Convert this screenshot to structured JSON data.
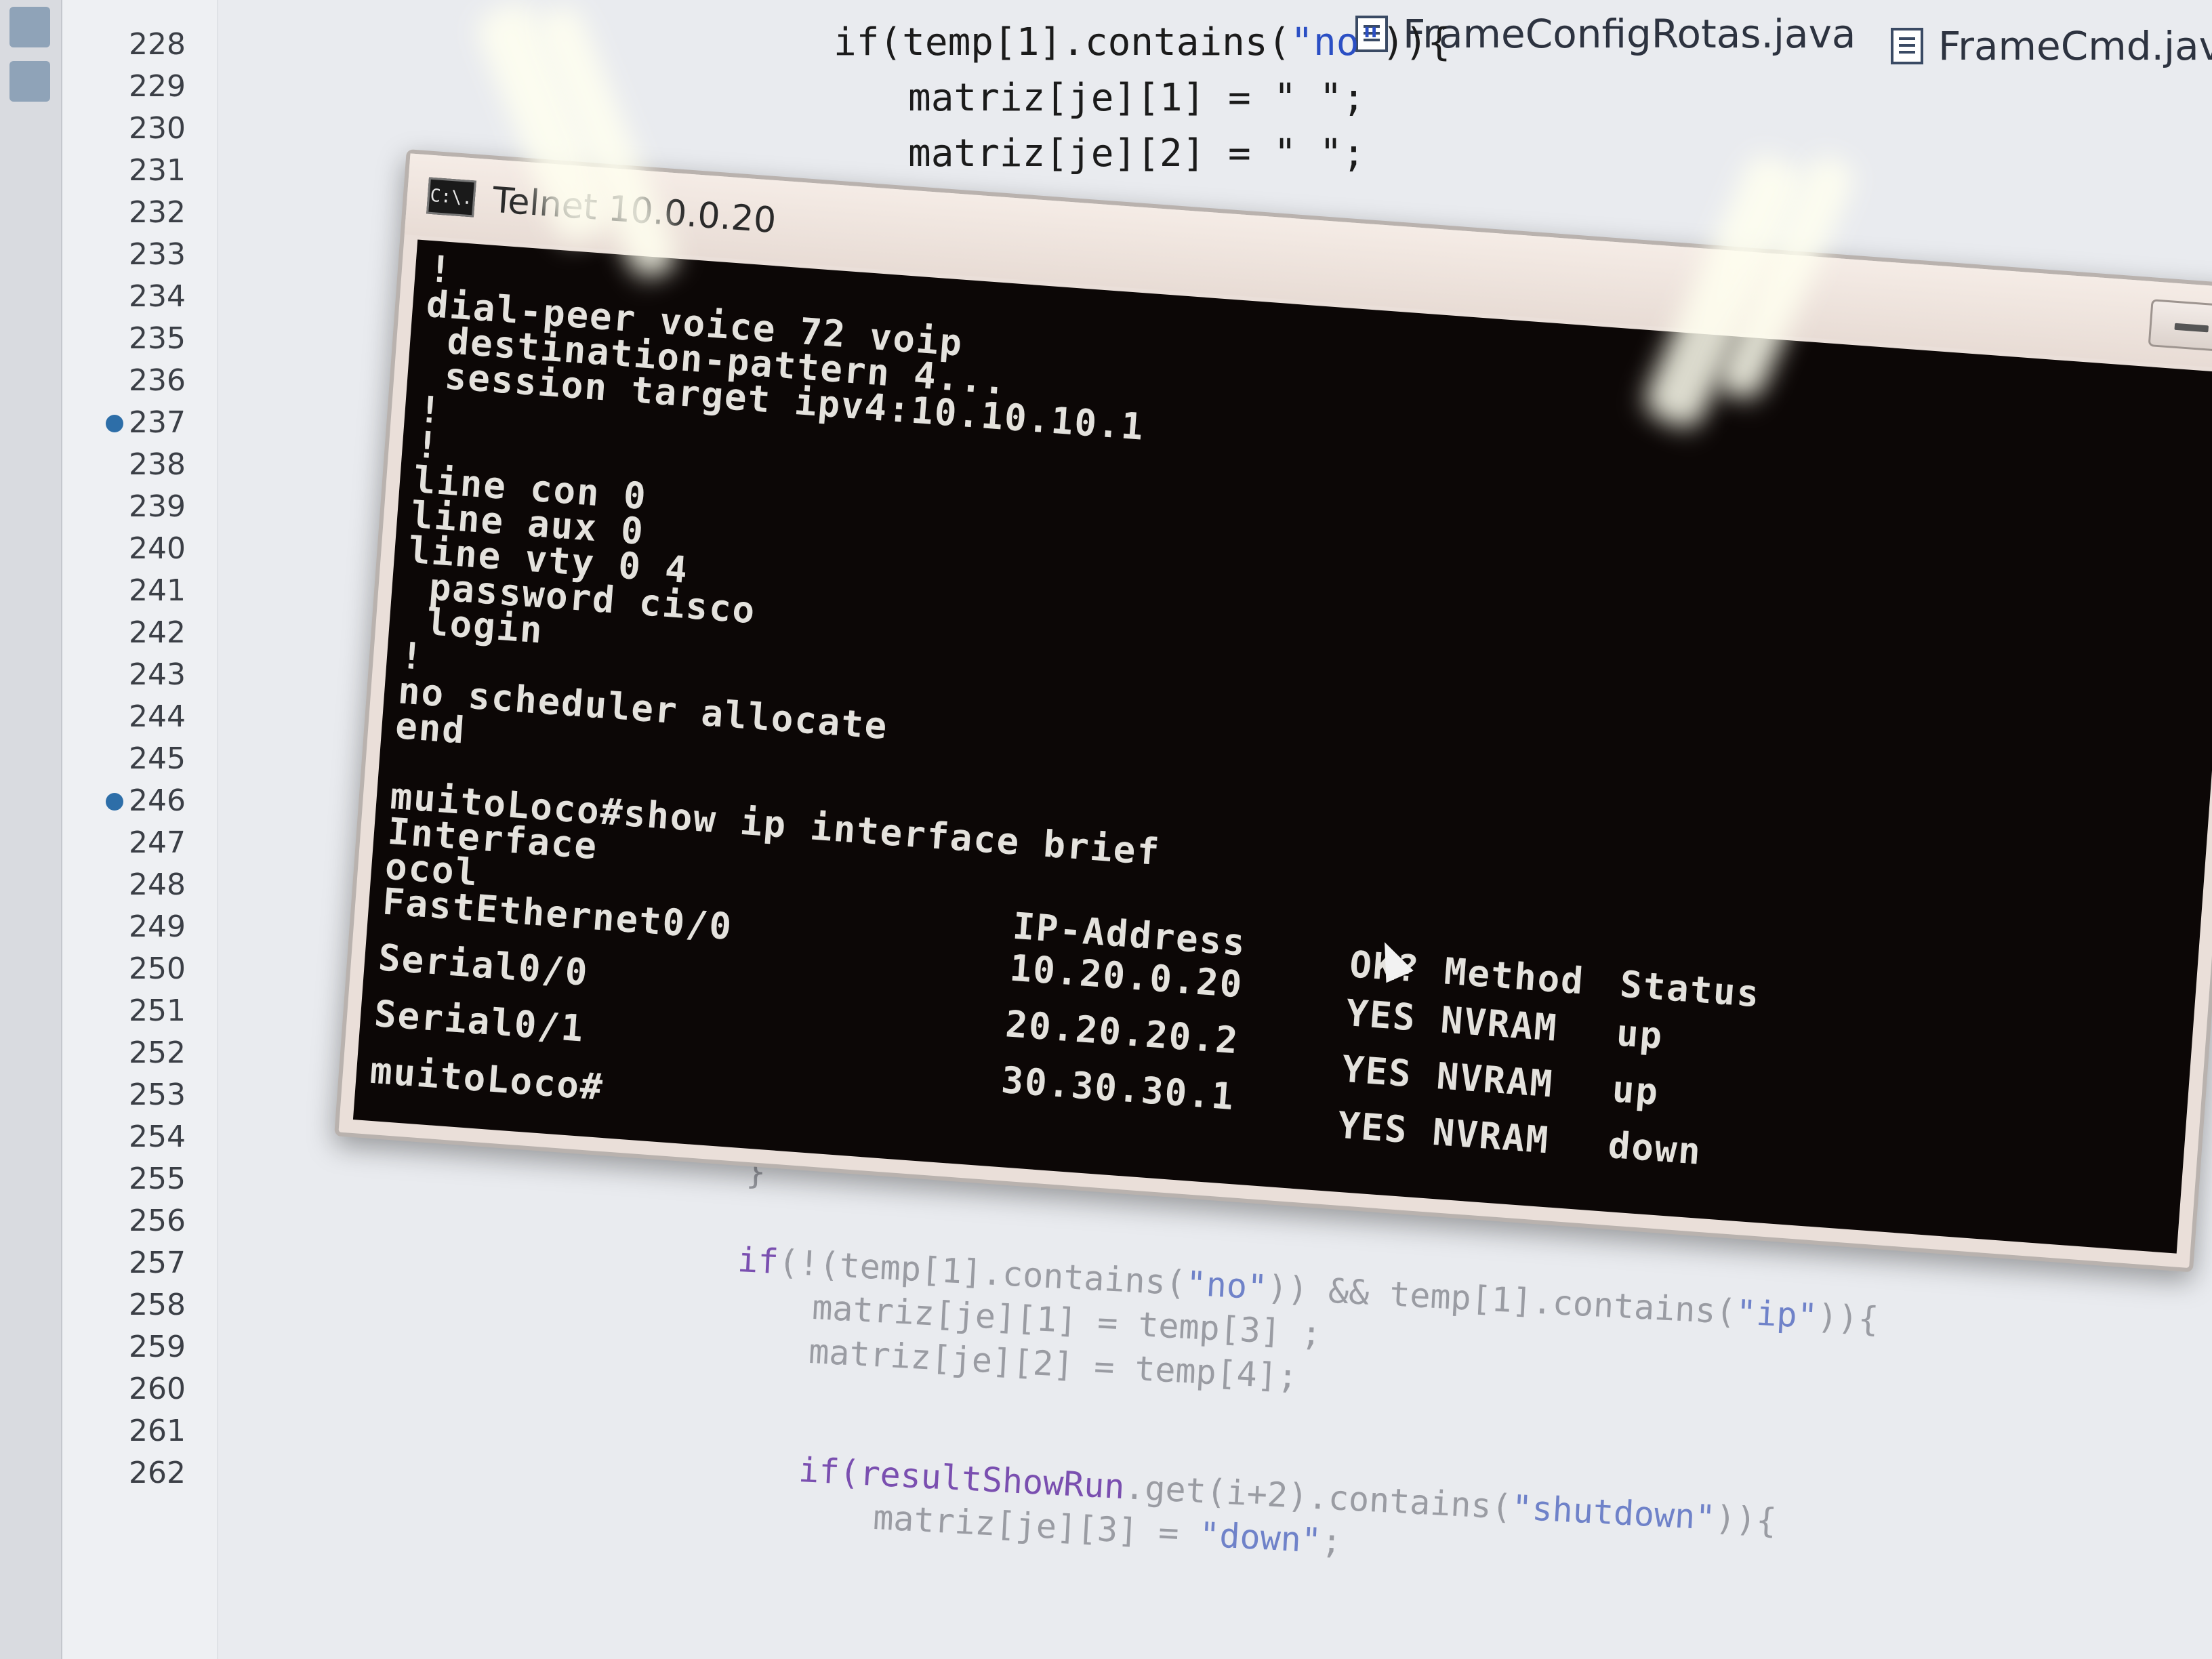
{
  "editor": {
    "tabs": [
      {
        "label": "FrameConfigRotas.java"
      },
      {
        "label": "FrameCmd.java"
      }
    ],
    "line_numbers": [
      {
        "n": "228",
        "bp": false
      },
      {
        "n": "229",
        "bp": false
      },
      {
        "n": "230",
        "bp": false
      },
      {
        "n": "231",
        "bp": false
      },
      {
        "n": "232",
        "bp": false
      },
      {
        "n": "233",
        "bp": false
      },
      {
        "n": "234",
        "bp": false
      },
      {
        "n": "235",
        "bp": false
      },
      {
        "n": "236",
        "bp": false
      },
      {
        "n": "237",
        "bp": true
      },
      {
        "n": "238",
        "bp": false
      },
      {
        "n": "239",
        "bp": false
      },
      {
        "n": "240",
        "bp": false
      },
      {
        "n": "241",
        "bp": false
      },
      {
        "n": "242",
        "bp": false
      },
      {
        "n": "243",
        "bp": false
      },
      {
        "n": "244",
        "bp": false
      },
      {
        "n": "245",
        "bp": false
      },
      {
        "n": "246",
        "bp": true
      },
      {
        "n": "247",
        "bp": false
      },
      {
        "n": "248",
        "bp": false
      },
      {
        "n": "249",
        "bp": false
      },
      {
        "n": "250",
        "bp": false
      },
      {
        "n": "251",
        "bp": false
      },
      {
        "n": "252",
        "bp": false
      },
      {
        "n": "253",
        "bp": false
      },
      {
        "n": "254",
        "bp": false
      },
      {
        "n": "255",
        "bp": false
      },
      {
        "n": "256",
        "bp": false
      },
      {
        "n": "257",
        "bp": false
      },
      {
        "n": "258",
        "bp": false
      },
      {
        "n": "259",
        "bp": false
      },
      {
        "n": "260",
        "bp": false
      },
      {
        "n": "261",
        "bp": false
      },
      {
        "n": "262",
        "bp": false
      }
    ],
    "code_top": {
      "line1_a": "if(temp[1].contains(",
      "line1_str": "\"no\"",
      "line1_b": ")){",
      "line2": "matriz[je][1] = \" \";",
      "line3": "matriz[je][2] = \" \";"
    },
    "code_bottom": {
      "brace": "}",
      "if_kw": "if",
      "line_a1": "(!(temp[1].contains(",
      "line_a_str1": "\"no\"",
      "line_a2": ")) && temp[1].contains(",
      "line_a_str2": "\"ip\"",
      "line_a3": ")){",
      "line_b": "matriz[je][1] = temp[3] ;",
      "line_c": "matriz[je][2] = temp[4];",
      "if_kw2": "if",
      "line_d_ident": "(resultShowRun",
      "line_d_rest": ".get(i+2).contains(",
      "line_d_str": "\"shutdown\"",
      "line_d_end": ")){",
      "line_e_a": "matriz[je][3] = ",
      "line_e_str": "\"down\"",
      "line_e_b": ";"
    }
  },
  "telnet": {
    "title": "Telnet 10.0.0.20",
    "icon_text": "C:\\.",
    "config_lines": [
      "!",
      "dial-peer voice 72 voip",
      " destination-pattern 4...",
      " session target ipv4:10.10.10.1",
      "!",
      "!",
      "line con 0",
      "line aux 0",
      "line vty 0 4",
      " password cisco",
      " login",
      "!",
      "no scheduler allocate",
      "end",
      "",
      "muitoLoco#show ip interface brief"
    ],
    "table_header": {
      "interface": "Interface",
      "ip": "IP-Address",
      "ok": "OK?",
      "method": "Method",
      "status": "Status",
      "protocol_wrap": "ocol"
    },
    "rows": [
      {
        "interface": "FastEthernet0/0",
        "ip": "10.20.0.20",
        "ok": "YES",
        "method": "NVRAM",
        "status": "up"
      },
      {
        "interface": "Serial0/0",
        "ip": "20.20.20.2",
        "ok": "YES",
        "method": "NVRAM",
        "status": "up"
      },
      {
        "interface": "Serial0/1",
        "ip": "30.30.30.1",
        "ok": "YES",
        "method": "NVRAM",
        "status": "down"
      }
    ],
    "prompt": "muitoLoco#"
  }
}
